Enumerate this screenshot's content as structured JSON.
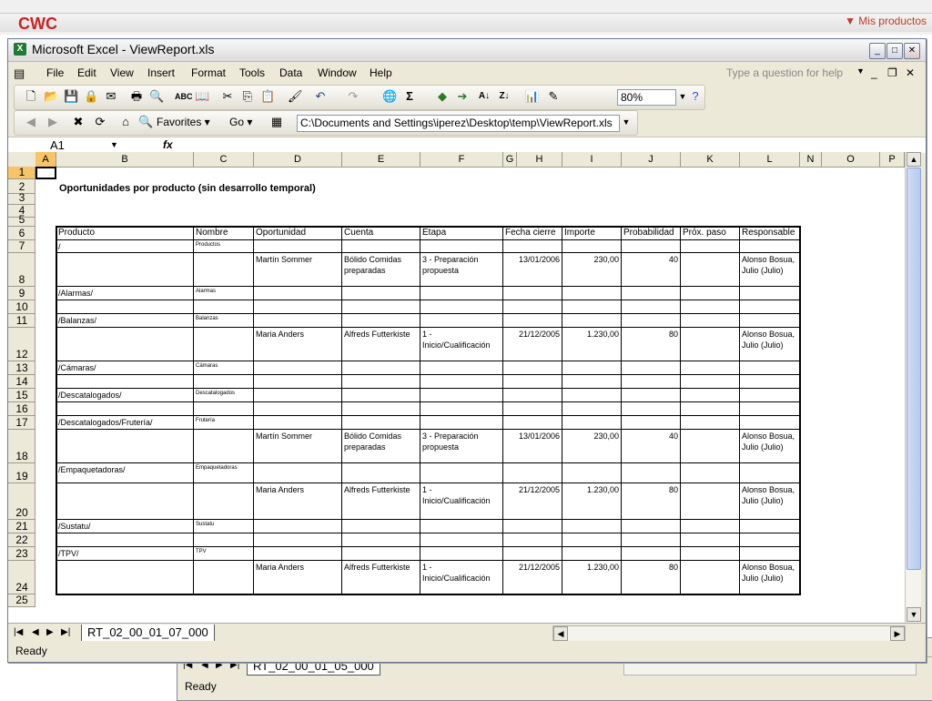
{
  "top_bar": {
    "logo": "CWC",
    "my_products": "▼ Mis productos"
  },
  "bg_window": {
    "sheet_tab": "RT_02_00_01_05_000",
    "status": "Ready"
  },
  "window": {
    "title": "Microsoft Excel - ViewReport.xls",
    "icon": "excel-icon"
  },
  "menu": {
    "items": [
      "File",
      "Edit",
      "View",
      "Insert",
      "Format",
      "Tools",
      "Data",
      "Window",
      "Help"
    ],
    "help_placeholder": "Type a question for help"
  },
  "toolbar": {
    "zoom": "80%",
    "sum_icon": "Σ"
  },
  "web_toolbar": {
    "favorites": "Favorites ▾",
    "go": "Go ▾",
    "address": "C:\\Documents and Settings\\iperez\\Desktop\\temp\\ViewReport.xls"
  },
  "formula_bar": {
    "name_box": "A1",
    "fx": "fx",
    "formula": ""
  },
  "grid": {
    "columns": [
      "A",
      "B",
      "C",
      "D",
      "E",
      "F",
      "G",
      "H",
      "I",
      "J",
      "K",
      "L",
      "N",
      "O",
      "P"
    ],
    "rows": [
      "1",
      "2",
      "3",
      "4",
      "5",
      "6",
      "7",
      "8",
      "9",
      "10",
      "11",
      "12",
      "13",
      "14",
      "15",
      "16",
      "17",
      "18",
      "19",
      "20",
      "21",
      "22",
      "23",
      "24",
      "25"
    ],
    "title": "Oportunidades por producto (sin desarrollo temporal)"
  },
  "report": {
    "headers": [
      "Producto",
      "Nombre",
      "Oportunidad",
      "Cuenta",
      "Etapa",
      "Fecha cierre",
      "Importe",
      "Probabilidad",
      "Próx. paso",
      "Responsable"
    ],
    "rows": [
      {
        "producto": "/",
        "nombre": "Productos",
        "oportunidad": "",
        "cuenta": "",
        "etapa": "",
        "fecha": "",
        "importe": "",
        "prob": "",
        "prox": "",
        "resp": ""
      },
      {
        "producto": "",
        "nombre": "",
        "oportunidad": "Martín Sommer",
        "cuenta": "Bólido Comidas preparadas",
        "etapa": "3 - Preparación propuesta",
        "fecha": "13/01/2006",
        "importe": "230,00",
        "prob": "40",
        "prox": "",
        "resp": "Alonso Bosua, Julio (Julio)"
      },
      {
        "producto": "/Alarmas/",
        "nombre": "Alarmas",
        "oportunidad": "",
        "cuenta": "",
        "etapa": "",
        "fecha": "",
        "importe": "",
        "prob": "",
        "prox": "",
        "resp": ""
      },
      {
        "producto": "",
        "nombre": "",
        "oportunidad": "",
        "cuenta": "",
        "etapa": "",
        "fecha": "",
        "importe": "",
        "prob": "",
        "prox": "",
        "resp": ""
      },
      {
        "producto": "/Balanzas/",
        "nombre": "Balanzas",
        "oportunidad": "",
        "cuenta": "",
        "etapa": "",
        "fecha": "",
        "importe": "",
        "prob": "",
        "prox": "",
        "resp": ""
      },
      {
        "producto": "",
        "nombre": "",
        "oportunidad": "Maria Anders",
        "cuenta": "Alfreds Futterkiste",
        "etapa": "1 - Inicio/Cualificación",
        "fecha": "21/12/2005",
        "importe": "1.230,00",
        "prob": "80",
        "prox": "",
        "resp": "Alonso Bosua, Julio (Julio)"
      },
      {
        "producto": "/Cámaras/",
        "nombre": "Cámaras",
        "oportunidad": "",
        "cuenta": "",
        "etapa": "",
        "fecha": "",
        "importe": "",
        "prob": "",
        "prox": "",
        "resp": ""
      },
      {
        "producto": "",
        "nombre": "",
        "oportunidad": "",
        "cuenta": "",
        "etapa": "",
        "fecha": "",
        "importe": "",
        "prob": "",
        "prox": "",
        "resp": ""
      },
      {
        "producto": "/Descatalogados/",
        "nombre": "Descatalogados",
        "oportunidad": "",
        "cuenta": "",
        "etapa": "",
        "fecha": "",
        "importe": "",
        "prob": "",
        "prox": "",
        "resp": ""
      },
      {
        "producto": "",
        "nombre": "",
        "oportunidad": "",
        "cuenta": "",
        "etapa": "",
        "fecha": "",
        "importe": "",
        "prob": "",
        "prox": "",
        "resp": ""
      },
      {
        "producto": "/Descatalogados/Frutería/",
        "nombre": "Frutería",
        "oportunidad": "",
        "cuenta": "",
        "etapa": "",
        "fecha": "",
        "importe": "",
        "prob": "",
        "prox": "",
        "resp": ""
      },
      {
        "producto": "",
        "nombre": "",
        "oportunidad": "Martín Sommer",
        "cuenta": "Bólido Comidas preparadas",
        "etapa": "3 - Preparación propuesta",
        "fecha": "13/01/2006",
        "importe": "230,00",
        "prob": "40",
        "prox": "",
        "resp": "Alonso Bosua, Julio (Julio)"
      },
      {
        "producto": "/Empaquetadoras/",
        "nombre": "Empaquetadoras",
        "oportunidad": "",
        "cuenta": "",
        "etapa": "",
        "fecha": "",
        "importe": "",
        "prob": "",
        "prox": "",
        "resp": ""
      },
      {
        "producto": "",
        "nombre": "",
        "oportunidad": "Maria Anders",
        "cuenta": "Alfreds Futterkiste",
        "etapa": "1 - Inicio/Cualificación",
        "fecha": "21/12/2005",
        "importe": "1.230,00",
        "prob": "80",
        "prox": "",
        "resp": "Alonso Bosua, Julio (Julio)"
      },
      {
        "producto": "/Sustatu/",
        "nombre": "Sustatu",
        "oportunidad": "",
        "cuenta": "",
        "etapa": "",
        "fecha": "",
        "importe": "",
        "prob": "",
        "prox": "",
        "resp": ""
      },
      {
        "producto": "",
        "nombre": "",
        "oportunidad": "",
        "cuenta": "",
        "etapa": "",
        "fecha": "",
        "importe": "",
        "prob": "",
        "prox": "",
        "resp": ""
      },
      {
        "producto": "/TPV/",
        "nombre": "TPV",
        "oportunidad": "",
        "cuenta": "",
        "etapa": "",
        "fecha": "",
        "importe": "",
        "prob": "",
        "prox": "",
        "resp": ""
      },
      {
        "producto": "",
        "nombre": "",
        "oportunidad": "Maria Anders",
        "cuenta": "Alfreds Futterkiste",
        "etapa": "1 - Inicio/Cualificación",
        "fecha": "21/12/2005",
        "importe": "1.230,00",
        "prob": "80",
        "prox": "",
        "resp": "Alonso Bosua, Julio (Julio)"
      }
    ]
  },
  "sheet_tabs": {
    "active": "RT_02_00_01_07_000"
  },
  "status": {
    "text": "Ready"
  },
  "colors": {
    "selected_header": "#f7c46a",
    "chrome": "#ece9d8",
    "excel_green": "#1e7a34",
    "accent_red": "#c0392b"
  }
}
